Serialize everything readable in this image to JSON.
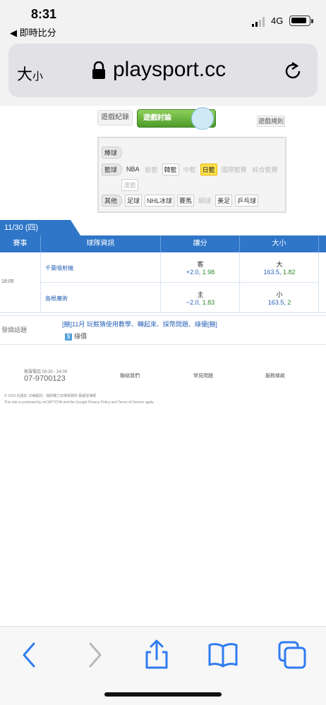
{
  "status_bar": {
    "time": "8:31",
    "back_app": "◀ 即時比分",
    "network": "4G"
  },
  "url_bar": {
    "text_size": "大",
    "text_size_small": "小",
    "host": "playsport.cc"
  },
  "game_tabs": {
    "record": "遊戲紀錄",
    "discussion": "遊戲討論",
    "rules": "遊戲規則"
  },
  "sports_menu": {
    "baseball": "棒球",
    "basketball": "籃球",
    "basketball_leagues": [
      "NBA",
      "歐籃",
      "韓籃",
      "中籃",
      "日籃",
      "國際籃賽",
      "綜合籃賽",
      "澳籃"
    ],
    "other": "其他",
    "other_leagues": [
      "足球",
      "NHL冰球",
      "賽馬",
      "網球",
      "美足",
      "乒乓球"
    ]
  },
  "date_tab": "11/30 (四)",
  "table_headers": {
    "event": "賽事",
    "teams": "球隊資訊",
    "spread": "讓分",
    "total": "大小"
  },
  "match": {
    "time": "18:05",
    "away_team": "千葉噴射機",
    "home_team": "島根魔術",
    "away_label": "客",
    "home_label": "主",
    "away_spread": "+2.0,",
    "away_spread_odds": "1.98",
    "home_spread": "−2.0,",
    "home_spread_odds": "1.83",
    "over_label": "大",
    "under_label": "小",
    "over_line": "163.5,",
    "over_odds": "1.82",
    "under_line": "163.5,",
    "under_odds": "2"
  },
  "topics": {
    "label": "發燒話題",
    "line1": "[囍]11月 玩競猜使用教學、轉起來、採幣問題、綠優[囍]",
    "line2_icon": "$",
    "line2": "綠價"
  },
  "footer": {
    "phone_label": "客服電話 09:30 - 24:00",
    "phone": "07-9700123",
    "links": [
      "聯絡我們",
      "常見問題",
      "服務條款"
    ],
    "copyright": "© 2023 玩運彩 法律顧問：滿辰輝力法律事務所 蔡顧宏律師",
    "recaptcha": "This site is protected by reCAPTCHA and the Google Privacy Policy and Terms of Service apply."
  }
}
